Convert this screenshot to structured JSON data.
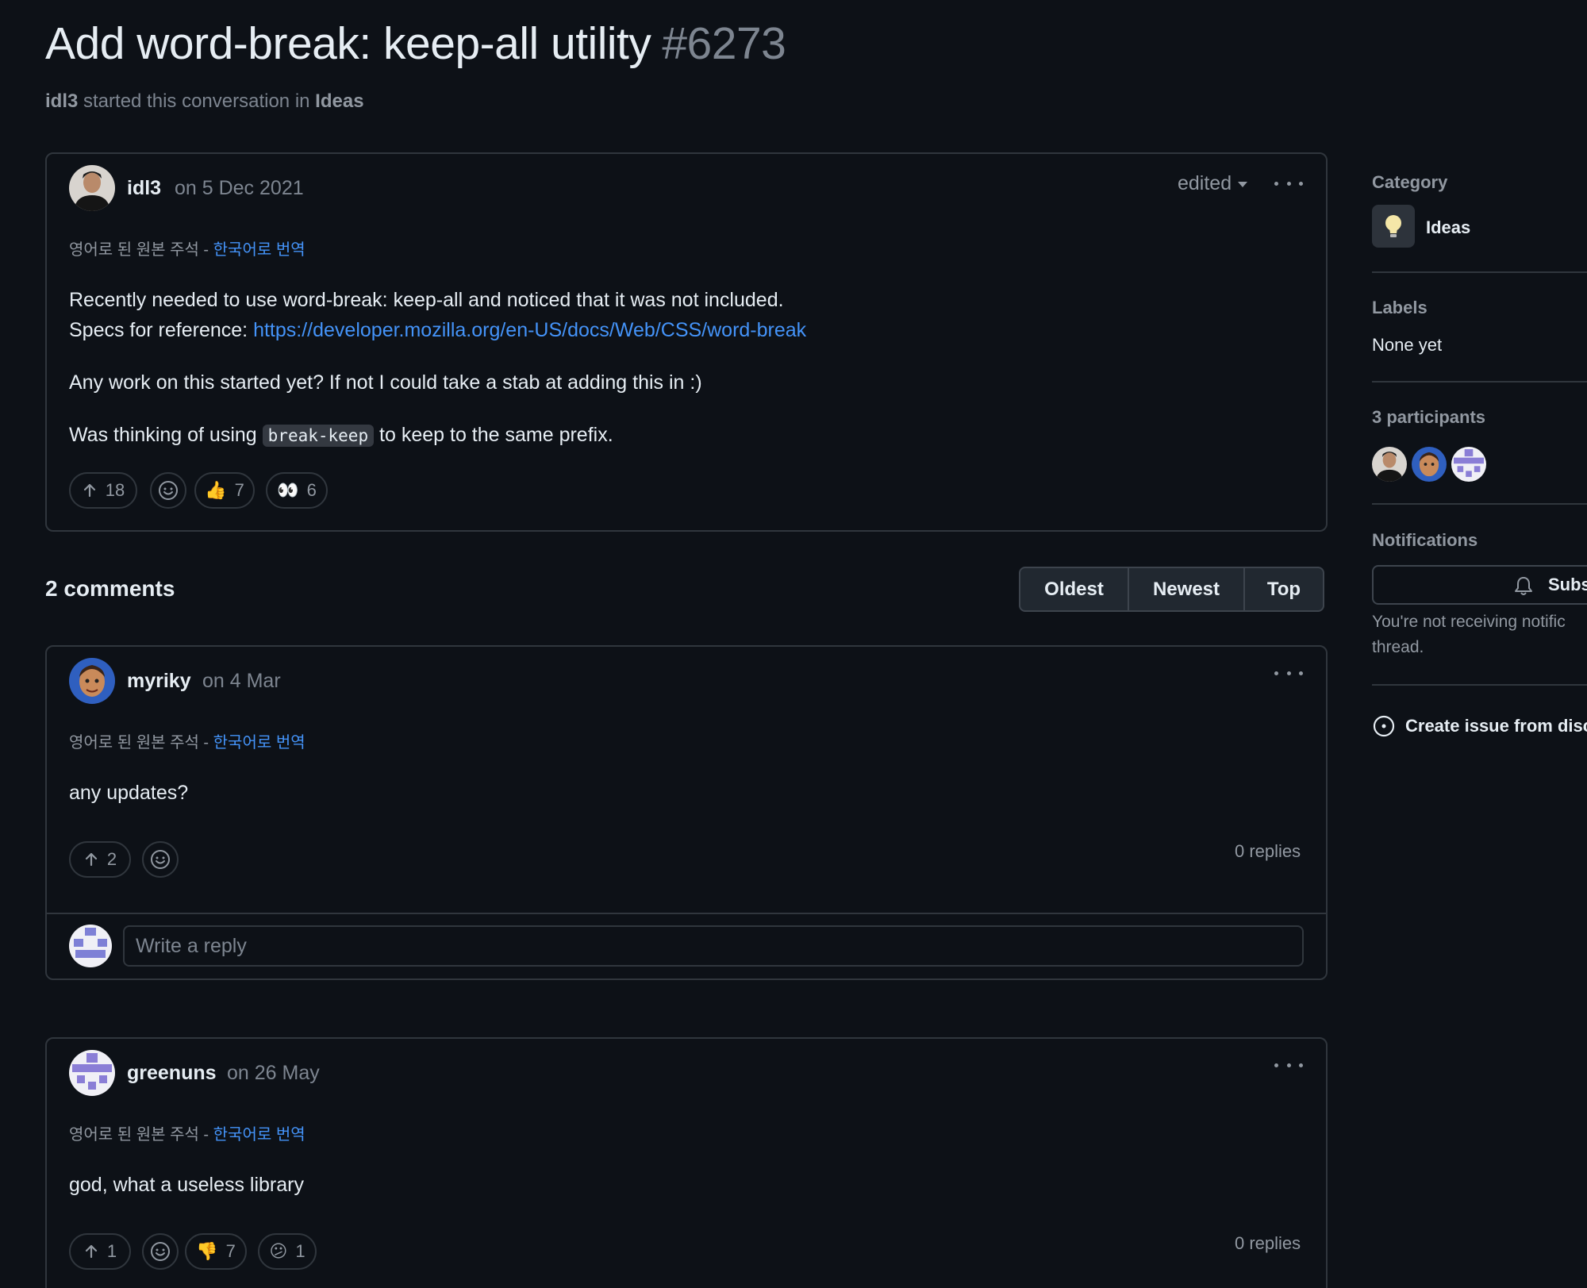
{
  "header": {
    "title": "Add word-break: keep-all utility",
    "number": "#6273",
    "author": "idl3",
    "started_text": "started this conversation in",
    "category": "Ideas"
  },
  "post": {
    "author": "idl3",
    "date": "on 5 Dec 2021",
    "edited_label": "edited",
    "translation_prefix": "영어로 된 원본 주석 -",
    "translation_link": "한국어로 번역",
    "line1": "Recently needed to use word-break: keep-all and noticed that it was not included.",
    "line2_prefix": "Specs for reference:",
    "line2_link": "https://developer.mozilla.org/en-US/docs/Web/CSS/word-break",
    "line3": "Any work on this started yet? If not I could take a stab at adding this in :)",
    "line4_prefix": "Was thinking of using",
    "line4_code": "break-keep",
    "line4_suffix": "to keep to the same prefix.",
    "upvotes": "18",
    "reactions": [
      {
        "emoji": "👍",
        "count": "7"
      },
      {
        "emoji": "👀",
        "count": "6"
      }
    ]
  },
  "comments_header": {
    "count_label": "2 comments",
    "sort": [
      "Oldest",
      "Newest",
      "Top"
    ]
  },
  "comments": [
    {
      "author": "myriky",
      "date": "on 4 Mar",
      "translation_prefix": "영어로 된 원본 주석 -",
      "translation_link": "한국어로 번역",
      "body": "any updates?",
      "upvotes": "2",
      "replies": "0 replies",
      "reply_placeholder": "Write a reply"
    },
    {
      "author": "greenuns",
      "date": "on 26 May",
      "translation_prefix": "영어로 된 원본 주석 -",
      "translation_link": "한국어로 번역",
      "body": "god, what a useless library",
      "upvotes": "1",
      "reactions": [
        {
          "emoji": "👎",
          "count": "7"
        },
        {
          "emoji": "😕",
          "count": "1"
        }
      ],
      "replies": "0 replies"
    }
  ],
  "sidebar": {
    "category_label": "Category",
    "category_value": "Ideas",
    "labels_label": "Labels",
    "labels_value": "None yet",
    "participants_label": "3 participants",
    "notifications_label": "Notifications",
    "subscribe_label": "Subs",
    "notif_text_1": "You're not receiving notific",
    "notif_text_2": "thread.",
    "create_issue_label": "Create issue from disc"
  }
}
